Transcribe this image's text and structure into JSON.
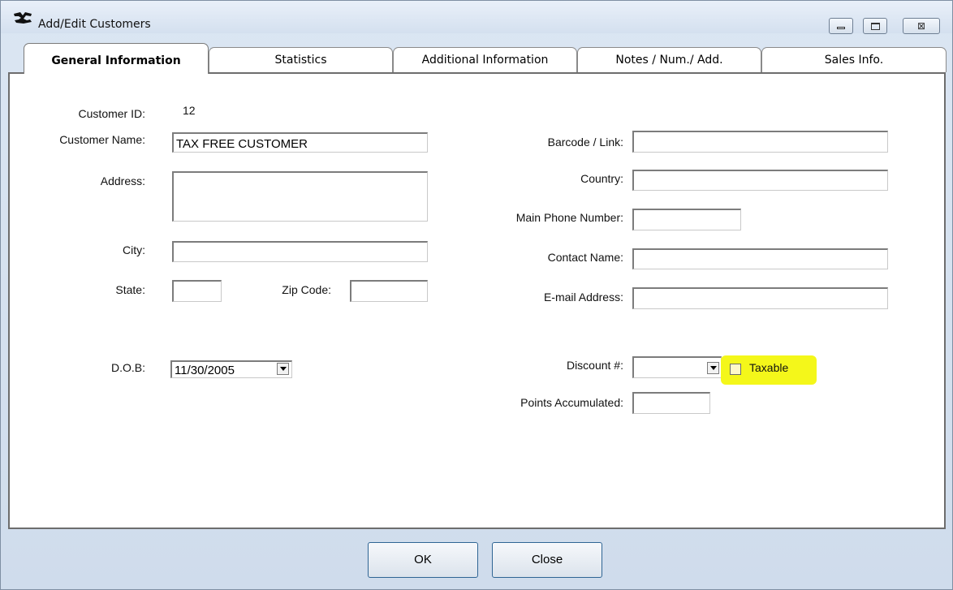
{
  "window": {
    "title": "Add/Edit Customers",
    "icon": "app-logo-icon",
    "controls": [
      "minimize-icon",
      "maximize-icon",
      "close-icon"
    ],
    "close_glyph": "⊠"
  },
  "tabs": [
    {
      "label": "General Information",
      "active": true
    },
    {
      "label": "Statistics",
      "active": false
    },
    {
      "label": "Additional Information",
      "active": false
    },
    {
      "label": "Notes / Num./ Add.",
      "active": false
    },
    {
      "label": "Sales Info.",
      "active": false
    }
  ],
  "form": {
    "customer_id": {
      "label": "Customer ID:",
      "value": "12"
    },
    "customer_name": {
      "label": "Customer Name:",
      "value": "TAX FREE CUSTOMER"
    },
    "address": {
      "label": "Address:",
      "value": ""
    },
    "city": {
      "label": "City:",
      "value": ""
    },
    "state": {
      "label": "State:",
      "value": ""
    },
    "zip": {
      "label": "Zip Code:",
      "value": ""
    },
    "dob": {
      "label": "D.O.B:",
      "value": "11/30/2005"
    },
    "barcode": {
      "label": "Barcode / Link:",
      "value": ""
    },
    "country": {
      "label": "Country:",
      "value": ""
    },
    "main_phone": {
      "label": "Main Phone Number:",
      "value": ""
    },
    "contact_name": {
      "label": "Contact Name:",
      "value": ""
    },
    "email": {
      "label": "E-mail Address:",
      "value": ""
    },
    "discount": {
      "label": "Discount #:",
      "value": ""
    },
    "taxable": {
      "label": "Taxable",
      "checked": false
    },
    "points": {
      "label": "Points Accumulated:",
      "value": ""
    }
  },
  "buttons": {
    "ok": "OK",
    "close": "Close"
  },
  "colors": {
    "highlight": "#f4f71a",
    "button_border": "#2f6594"
  }
}
